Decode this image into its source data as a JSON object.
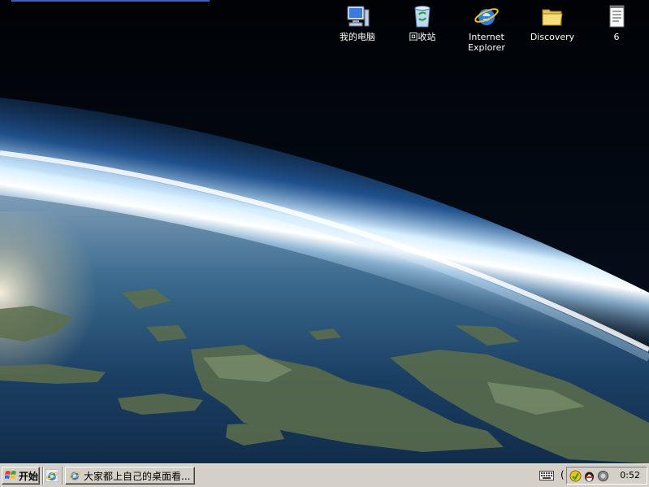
{
  "desktop": {
    "icons": [
      {
        "label": "我的电脑",
        "icon": "my-computer-icon"
      },
      {
        "label": "回收站",
        "icon": "recycle-bin-icon"
      },
      {
        "label": "Internet\nExplorer",
        "icon": "internet-explorer-icon"
      },
      {
        "label": "Discovery",
        "icon": "folder-icon"
      },
      {
        "label": "6",
        "icon": "text-document-icon"
      }
    ]
  },
  "taskbar": {
    "start_label": "开始",
    "task_label": "大家都上自己的桌面看...",
    "clock": "0:52"
  },
  "colors": {
    "taskbar": "#d4d0c8",
    "atmosphere": "#9fd0ff",
    "space": "#02060d"
  }
}
